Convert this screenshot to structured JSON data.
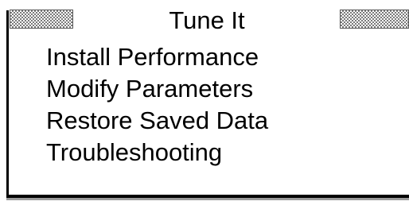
{
  "screen": {
    "title": "Tune It"
  },
  "menu": {
    "items": [
      {
        "label": "Install Performance"
      },
      {
        "label": "Modify Parameters"
      },
      {
        "label": "Restore Saved Data"
      },
      {
        "label": "Troubleshooting"
      }
    ]
  }
}
